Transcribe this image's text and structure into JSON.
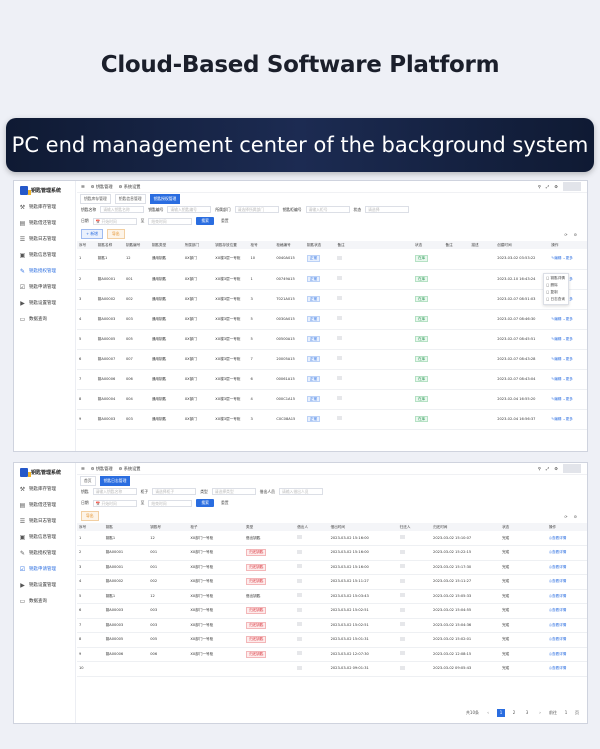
{
  "headline": "Cloud-Based Software Platform",
  "banner": "PC end management center of the background system",
  "colors": {
    "accent": "#2a6de0",
    "banner_dark": "#0f1a33",
    "tag_green": "#2f9b59",
    "tag_red": "#d9363e"
  },
  "app": {
    "logo_text": "钥匙管理系统"
  },
  "sidebar": [
    {
      "icon": "wrench-icon",
      "label": "钥匙库存管理"
    },
    {
      "icon": "file-icon",
      "label": "钥匙借还管理"
    },
    {
      "icon": "list-icon",
      "label": "钥匙日志管理"
    },
    {
      "icon": "clipboard-icon",
      "label": "钥匙信息管理"
    },
    {
      "icon": "pen-icon",
      "label": "钥匙授权管理"
    },
    {
      "icon": "check-icon",
      "label": "钥匙申请管理"
    },
    {
      "icon": "play-icon",
      "label": "钥匙设置管理"
    },
    {
      "icon": "monitor-icon",
      "label": "数据查询"
    }
  ],
  "panel1": {
    "breadcrumb": "钥匙管理",
    "breadcrumb2": "系统设置",
    "tabs": [
      "钥匙库存管理",
      "钥匙信息管理",
      "钥匙授权管理"
    ],
    "filters": [
      {
        "label": "钥匙名称",
        "placeholder": "请输入钥匙名称"
      },
      {
        "label": "钥匙编号",
        "placeholder": "请输入钥匙编号"
      },
      {
        "label": "所属部门",
        "placeholder": "请选择所属部门"
      },
      {
        "label": "钥匙柜编号",
        "placeholder": "请输入柜号"
      },
      {
        "label": "状态",
        "placeholder": "请选择"
      }
    ],
    "date_label": "日期",
    "date_start": "开始时间",
    "date_sep": "至",
    "date_end": "结束时间",
    "search_btn": "搜索",
    "reset_btn": "重置",
    "new_btn": "+ 新增",
    "export_btn": "导出",
    "columns": [
      "序号",
      "钥匙名称",
      "钥匙编号",
      "钥匙类型",
      "所属部门",
      "钥匙存放位置",
      "柜号",
      "柜格编号",
      "钥匙状态",
      "备注",
      "",
      "",
      "状态",
      "备注",
      "描述",
      "创建时间",
      "操作"
    ],
    "rows": [
      {
        "no": "1",
        "name": "钥匙1",
        "code": "12",
        "type": "通用钥匙",
        "dept": "XX部门",
        "pos": "XX楼3层一号柜",
        "cab": "10",
        "cell": "0040A015",
        "kstat": "正常",
        "st": "在库",
        "time": "2023-03-02 03:53:22"
      },
      {
        "no": "2",
        "name": "钥A00001",
        "code": "001",
        "type": "通用钥匙",
        "dept": "XX部门",
        "pos": "XX楼3层一号柜",
        "cab": "1",
        "cell": "00749A15",
        "kstat": "正常",
        "st": "在库",
        "time": "2023-02-10 16:43:24"
      },
      {
        "no": "3",
        "name": "钥A00002",
        "code": "002",
        "type": "通用钥匙",
        "dept": "XX部门",
        "pos": "XX楼3层一号柜",
        "cab": "3",
        "cell": "T021A015",
        "kstat": "正常",
        "st": "在库",
        "time": "2023-02-07 08:51:03"
      },
      {
        "no": "4",
        "name": "钥A00003",
        "code": "003",
        "type": "通用钥匙",
        "dept": "XX部门",
        "pos": "XX楼3层一号柜",
        "cab": "5",
        "cell": "0030A015",
        "kstat": "正常",
        "st": "在库",
        "time": "2023-02-07 08:46:30"
      },
      {
        "no": "5",
        "name": "钥A00005",
        "code": "005",
        "type": "通用钥匙",
        "dept": "XX部门",
        "pos": "XX楼3层一号柜",
        "cab": "5",
        "cell": "00500A15",
        "kstat": "正常",
        "st": "在库",
        "time": "2023-02-07 08:45:51"
      },
      {
        "no": "6",
        "name": "钥A00007",
        "code": "007",
        "type": "通用钥匙",
        "dept": "XX部门",
        "pos": "XX楼3层一号柜",
        "cab": "7",
        "cell": "20005A15",
        "kstat": "正常",
        "st": "在库",
        "time": "2023-02-07 08:43:28"
      },
      {
        "no": "7",
        "name": "钥A00006",
        "code": "006",
        "type": "通用钥匙",
        "dept": "XX部门",
        "pos": "XX楼3层一号柜",
        "cab": "6",
        "cell": "00061A15",
        "kstat": "正常",
        "st": "在库",
        "time": "2023-02-07 08:43:04"
      },
      {
        "no": "8",
        "name": "钥A00004",
        "code": "004",
        "type": "通用钥匙",
        "dept": "XX部门",
        "pos": "XX楼3层一号柜",
        "cab": "4",
        "cell": "000C1A15",
        "kstat": "正常",
        "st": "在库",
        "time": "2023-02-04 16:55:20"
      },
      {
        "no": "9",
        "name": "钥A00003",
        "code": "003",
        "type": "通用钥匙",
        "dept": "XX部门",
        "pos": "XX楼3层一号柜",
        "cab": "3",
        "cell": "C0C08A15",
        "kstat": "正常",
        "st": "在库",
        "time": "2023-02-04 16:56:37"
      }
    ],
    "op_edit": "编辑",
    "op_more": "更多",
    "popup": [
      "钥匙详情",
      "删除",
      "复制",
      "日志查询"
    ]
  },
  "panel2": {
    "breadcrumb": "钥匙管理",
    "breadcrumb2": "系统设置",
    "tabs": [
      "首页",
      "钥匙日志管理"
    ],
    "filters": [
      {
        "label": "钥匙",
        "placeholder": "请输入钥匙名称"
      },
      {
        "label": "柜子",
        "placeholder": "请选择柜子"
      },
      {
        "label": "类型",
        "placeholder": "请选择类型"
      },
      {
        "label": "借出人员",
        "placeholder": "请输入借出人员"
      }
    ],
    "date_label": "日期",
    "date_start": "开始时间",
    "date_sep": "至",
    "date_end": "结束时间",
    "search_btn": "搜索",
    "reset_btn": "重置",
    "export_btn": "导出",
    "columns": [
      "序号",
      "钥匙",
      "钥匙号",
      "柜子",
      "类型",
      "借出人",
      "借出时间",
      "归还人",
      "归还时间",
      "状态",
      "操作"
    ],
    "rows": [
      {
        "no": "1",
        "key": "钥匙1",
        "code": "12",
        "cab": "XX部门一号柜",
        "type": "借出钥匙",
        "lent": "2023-03-02 15:16:00",
        "ret": "2023-03-02 15:10:07",
        "st": "完成"
      },
      {
        "no": "2",
        "key": "钥A00001",
        "code": "001",
        "cab": "XX部门一号柜",
        "type": "归还钥匙",
        "lent": "2023-03-02 15:16:00",
        "ret": "2023-03-02 15:22:15",
        "st": "完成"
      },
      {
        "no": "3",
        "key": "钥A00001",
        "code": "001",
        "cab": "XX部门一号柜",
        "type": "归还钥匙",
        "lent": "2023-03-02 15:16:00",
        "ret": "2023-03-02 15:17:30",
        "st": "完成"
      },
      {
        "no": "4",
        "key": "钥A00002",
        "code": "002",
        "cab": "XX部门一号柜",
        "type": "归还钥匙",
        "lent": "2023-03-02 15:11:27",
        "ret": "2023-03-02 15:11:27",
        "st": "完成"
      },
      {
        "no": "5",
        "key": "钥匙1",
        "code": "12",
        "cab": "XX部门一号柜",
        "type": "借出钥匙",
        "lent": "2023-03-02 15:03:43",
        "ret": "2023-03-02 15:05:33",
        "st": "完成"
      },
      {
        "no": "6",
        "key": "钥A00003",
        "code": "003",
        "cab": "XX部门一号柜",
        "type": "归还钥匙",
        "lent": "2023-03-02 15:02:51",
        "ret": "2023-03-02 15:04:55",
        "st": "完成"
      },
      {
        "no": "7",
        "key": "钥A00003",
        "code": "003",
        "cab": "XX部门一号柜",
        "type": "归还钥匙",
        "lent": "2023-03-02 15:02:51",
        "ret": "2023-03-02 15:04:36",
        "st": "完成"
      },
      {
        "no": "8",
        "key": "钥A00005",
        "code": "005",
        "cab": "XX部门一号柜",
        "type": "归还钥匙",
        "lent": "2023-03-02 15:01:31",
        "ret": "2023-03-02 15:02:01",
        "st": "完成"
      },
      {
        "no": "9",
        "key": "钥A00006",
        "code": "006",
        "cab": "XX部门一号柜",
        "type": "归还钥匙",
        "lent": "2023-03-02 12:07:30",
        "ret": "2023-03-02 12:08:15",
        "st": "完成"
      },
      {
        "no": "10",
        "key": "",
        "code": "",
        "cab": "",
        "type": "",
        "lent": "2023-03-02 09:01:31",
        "ret": "2023-03-02 09:05:43",
        "st": "完成"
      }
    ],
    "op_view": "查看详情",
    "pager": {
      "total": "共10条",
      "pages": [
        "1",
        "2",
        "3"
      ],
      "current": "1",
      "goto": "前往",
      "goto_page": "1",
      "page_unit": "页"
    }
  }
}
